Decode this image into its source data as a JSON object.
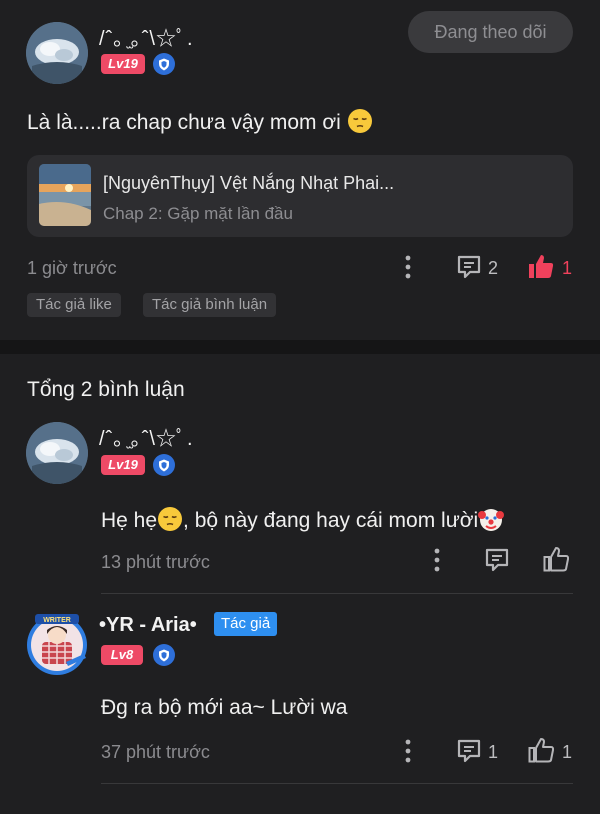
{
  "post": {
    "user_name": "/ˆ｡ ̫｡ˆ\\☆ﾟ.",
    "level": "Lv19",
    "follow_label": "Đang theo dõi",
    "text": "Là là.....ra chap chưa vậy mom ơi",
    "chapter": {
      "title": "[NguyênThụy] Vệt Nắng Nhạt Phai...",
      "subtitle": "Chap 2: Gặp mặt lần đầu"
    },
    "time": "1 giờ trước",
    "comment_count": "2",
    "like_count": "1",
    "tags": [
      "Tác giả like",
      "Tác giả bình luận"
    ]
  },
  "comments_header": "Tổng 2 bình luận",
  "comments": [
    {
      "user_name": "/ˆ｡ ̫｡ˆ\\☆ﾟ.",
      "level": "Lv19",
      "text_part1": "Hẹ hẹ",
      "text_part2": ", bộ này đang hay cái mom lười",
      "time": "13 phút trước"
    },
    {
      "user_name": "•YR - Aria•",
      "author_tag": "Tác giả",
      "level": "Lv8",
      "avatar_badge": "WRITER",
      "text": "Đg ra bộ mới aa~ Lười wa",
      "time": "37 phút trước",
      "comment_count": "1",
      "like_count": "1"
    }
  ],
  "colors": {
    "background": "#1f1f21",
    "level_badge": "#ee4a66",
    "author_tag": "#2e8ff0",
    "like_active": "#f0415c"
  },
  "icons": [
    "shield-icon",
    "more-icon",
    "comment-icon",
    "thumb-up-icon",
    "pensive-face-emoji",
    "clown-face-emoji"
  ]
}
